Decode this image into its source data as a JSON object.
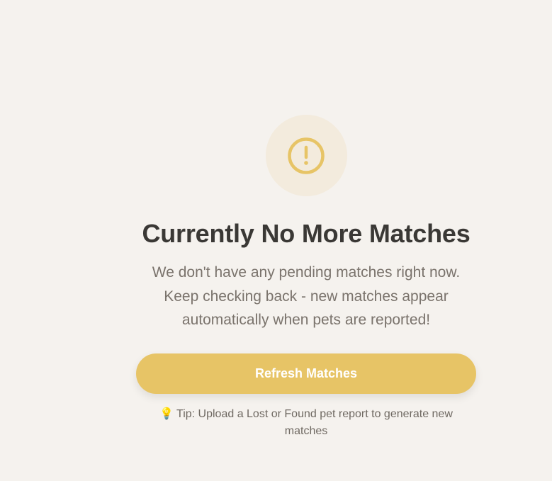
{
  "empty_state": {
    "icon": "alert-circle-icon",
    "title": "Currently No More Matches",
    "message": "We don't have any pending matches right now. Keep checking back - new matches appear automatically when pets are reported!",
    "refresh_label": "Refresh Matches",
    "tip_icon": "💡",
    "tip_text": "Tip: Upload a Lost or Found pet report to generate new matches"
  },
  "colors": {
    "background": "#f5f2ee",
    "accent": "#e7c466",
    "icon_circle": "#f3ebdd",
    "title": "#3a3835",
    "body_text": "#7a736c"
  }
}
